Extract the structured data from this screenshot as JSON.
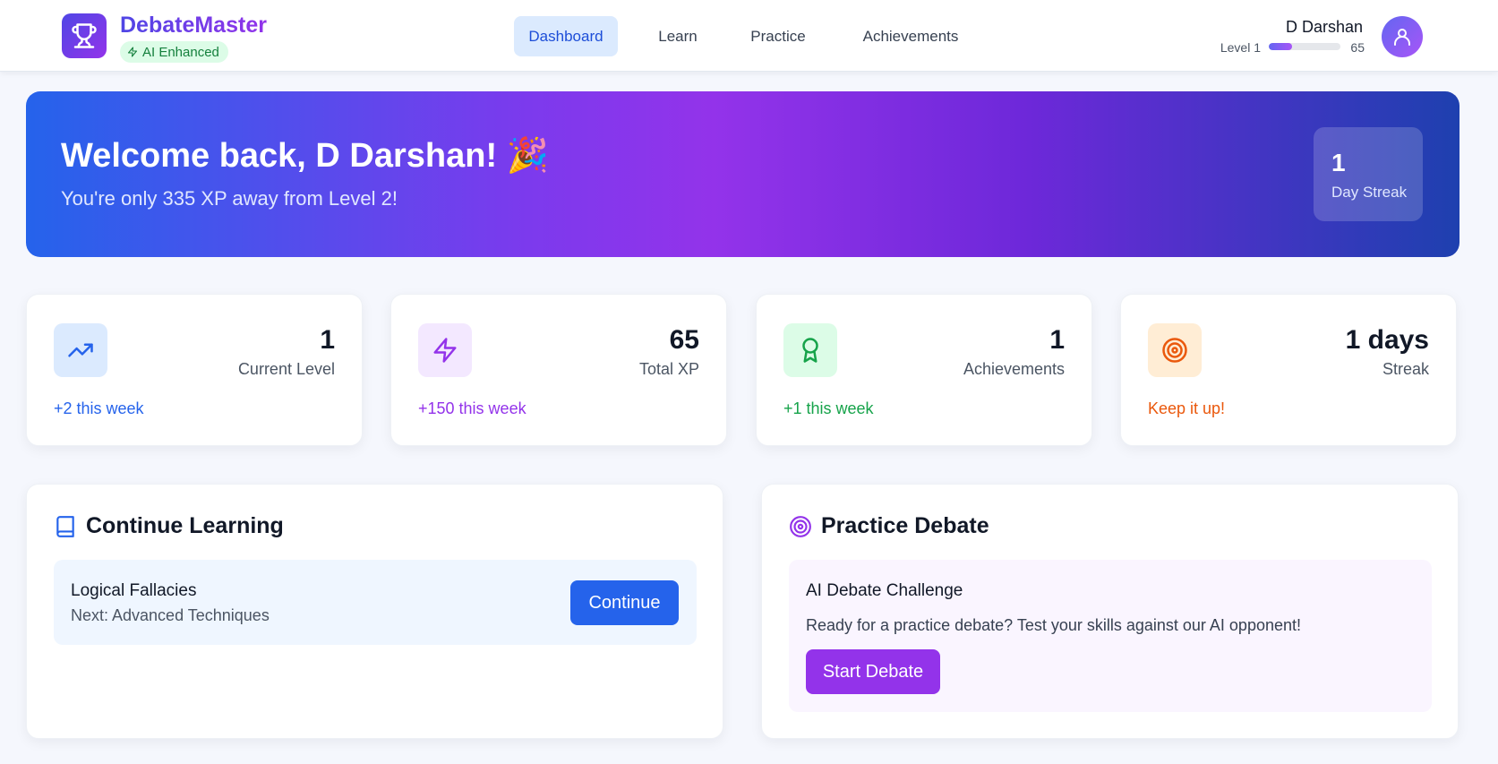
{
  "header": {
    "brand": "DebateMaster",
    "badge": "AI Enhanced",
    "logo_icon": "trophy-icon",
    "nav": [
      {
        "label": "Dashboard",
        "active": true
      },
      {
        "label": "Learn",
        "active": false
      },
      {
        "label": "Practice",
        "active": false
      },
      {
        "label": "Achievements",
        "active": false
      }
    ],
    "user": {
      "name": "D Darshan",
      "level_label": "Level 1",
      "xp": "65",
      "xp_progress": 0.33,
      "avatar_icon": "user-icon"
    }
  },
  "hero": {
    "title": "Welcome back, D Darshan! 🎉",
    "subtitle": "You're only 335 XP away from Level 2!",
    "streak_value": "1",
    "streak_label": "Day Streak"
  },
  "stats": [
    {
      "value": "1",
      "label": "Current Level",
      "trend": "+2 this week",
      "icon": "trending-up-icon",
      "color": "#2563eb",
      "bg": "#dbeafe"
    },
    {
      "value": "65",
      "label": "Total XP",
      "trend": "+150 this week",
      "icon": "lightning-icon",
      "color": "#9333ea",
      "bg": "#f3e8ff"
    },
    {
      "value": "1",
      "label": "Achievements",
      "trend": "+1 this week",
      "icon": "award-icon",
      "color": "#16a34a",
      "bg": "#dcfce7"
    },
    {
      "value": "1 days",
      "label": "Streak",
      "trend": "Keep it up!",
      "icon": "target-icon",
      "color": "#ea580c",
      "bg": "#ffedd5"
    }
  ],
  "continue_learning": {
    "heading": "Continue Learning",
    "icon": "book-icon",
    "topic": "Logical Fallacies",
    "next": "Next: Advanced Techniques",
    "button": "Continue"
  },
  "practice_debate": {
    "heading": "Practice Debate",
    "icon": "target-icon",
    "title": "AI Debate Challenge",
    "description": "Ready for a practice debate? Test your skills against our AI opponent!",
    "button": "Start Debate"
  }
}
